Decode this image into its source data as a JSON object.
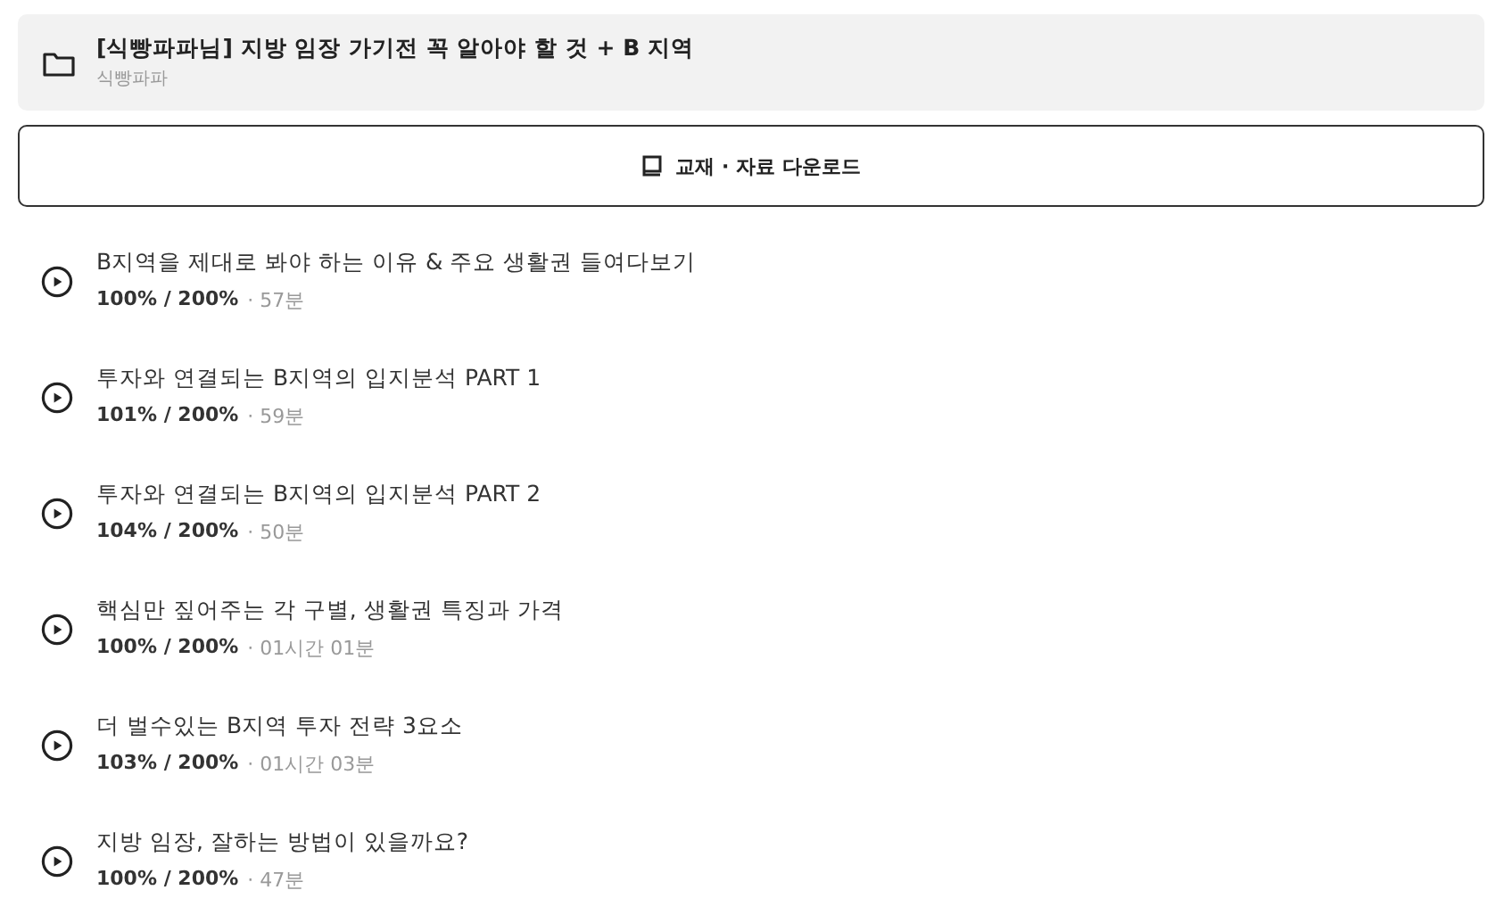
{
  "course": {
    "title": "[식빵파파님] 지방 임장 가기전 꼭 알아야 할 것 + B 지역",
    "author": "식빵파파"
  },
  "download_button": {
    "label": "교재 · 자료 다운로드"
  },
  "lessons": [
    {
      "title": "B지역을 제대로 봐야 하는 이유 & 주요 생활권 들여다보기",
      "progress": "100% / 200%",
      "duration": "· 57분"
    },
    {
      "title": "투자와 연결되는 B지역의 입지분석 PART 1",
      "progress": "101% / 200%",
      "duration": "· 59분"
    },
    {
      "title": "투자와 연결되는 B지역의 입지분석 PART 2",
      "progress": "104% / 200%",
      "duration": "· 50분"
    },
    {
      "title": "핵심만 짚어주는 각 구별, 생활권 특징과 가격",
      "progress": "100% / 200%",
      "duration": "· 01시간 01분"
    },
    {
      "title": "더 벌수있는 B지역 투자 전략 3요소",
      "progress": "103% / 200%",
      "duration": "· 01시간 03분"
    },
    {
      "title": "지방 임장, 잘하는 방법이 있을까요?",
      "progress": "100% / 200%",
      "duration": "· 47분"
    }
  ]
}
